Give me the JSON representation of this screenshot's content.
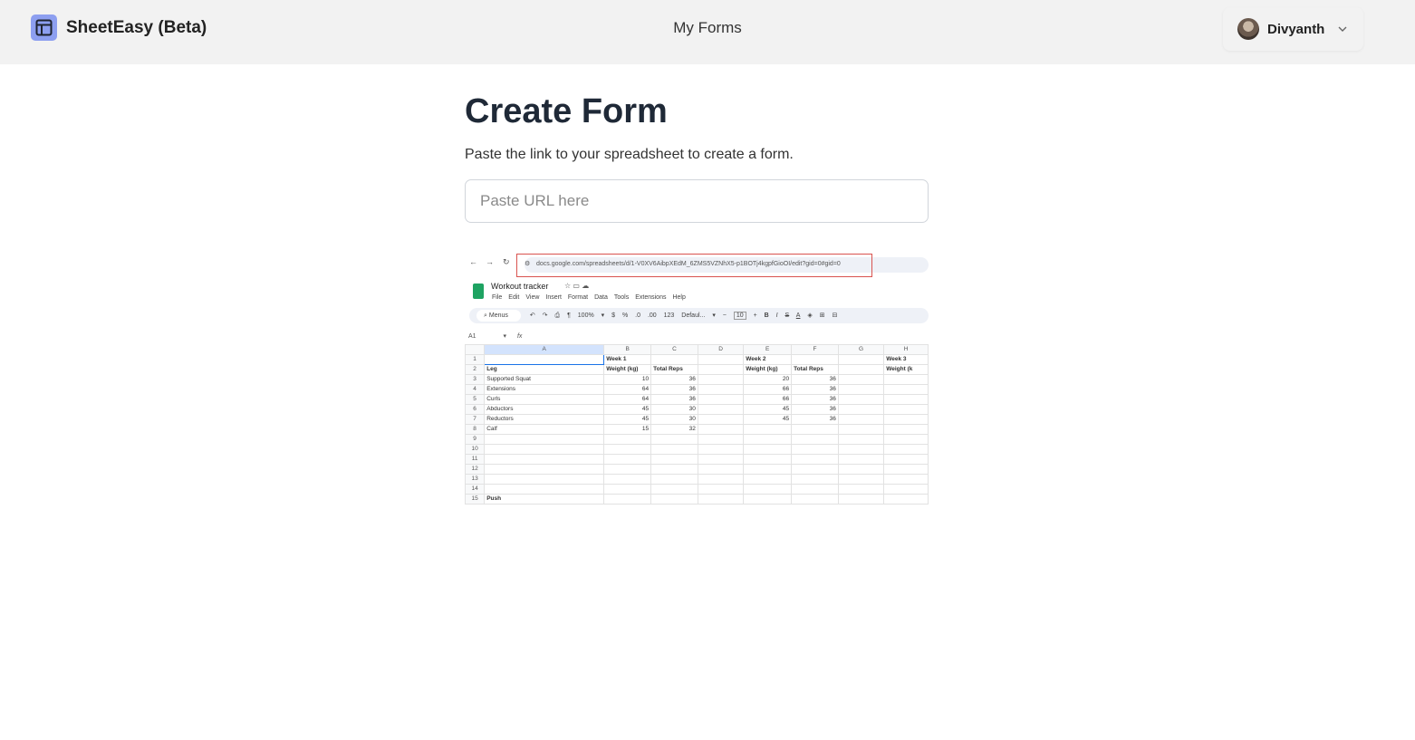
{
  "header": {
    "brand": "SheetEasy (Beta)",
    "nav_link": "My Forms",
    "user_name": "Divyanth"
  },
  "main": {
    "title": "Create Form",
    "subtitle": "Paste the link to your spreadsheet to create a form.",
    "url_placeholder": "Paste URL here"
  },
  "screenshot": {
    "url": "docs.google.com/spreadsheets/d/1-V0XV6AibpXEdM_6ZMS5VZNhX5-p1BOTj4kgpfGioOI/edit?gid=0#gid=0",
    "doc_title": "Workout tracker",
    "menus": [
      "File",
      "Edit",
      "View",
      "Insert",
      "Format",
      "Data",
      "Tools",
      "Extensions",
      "Help"
    ],
    "toolbar": {
      "search": "Menus",
      "zoom": "100%",
      "font": "Defaul...",
      "font_size": "10",
      "currency": "$",
      "percent": "%",
      "dec_minus": ".0",
      "dec_plus": ".00",
      "number_fmt": "123"
    },
    "cell_ref": "A1",
    "fx": "fx",
    "columns": [
      "A",
      "B",
      "C",
      "D",
      "E",
      "F",
      "G",
      "H"
    ],
    "rows": [
      {
        "n": "1",
        "cells": [
          "",
          "Week 1",
          "",
          "",
          "Week 2",
          "",
          "",
          "Week 3"
        ]
      },
      {
        "n": "2",
        "cells": [
          "Leg",
          "Weight (kg)",
          "Total Reps",
          "",
          "Weight (kg)",
          "Total Reps",
          "",
          "Weight (k"
        ]
      },
      {
        "n": "3",
        "cells": [
          "Supported Squat",
          "10",
          "36",
          "",
          "20",
          "36",
          "",
          ""
        ]
      },
      {
        "n": "4",
        "cells": [
          "Extensions",
          "64",
          "36",
          "",
          "66",
          "36",
          "",
          ""
        ]
      },
      {
        "n": "5",
        "cells": [
          "Curls",
          "64",
          "36",
          "",
          "66",
          "36",
          "",
          ""
        ]
      },
      {
        "n": "6",
        "cells": [
          "Abductors",
          "45",
          "30",
          "",
          "45",
          "36",
          "",
          ""
        ]
      },
      {
        "n": "7",
        "cells": [
          "Reductors",
          "45",
          "30",
          "",
          "45",
          "36",
          "",
          ""
        ]
      },
      {
        "n": "8",
        "cells": [
          "Calf",
          "15",
          "32",
          "",
          "",
          "",
          "",
          ""
        ]
      },
      {
        "n": "9",
        "cells": [
          "",
          "",
          "",
          "",
          "",
          "",
          "",
          ""
        ]
      },
      {
        "n": "10",
        "cells": [
          "",
          "",
          "",
          "",
          "",
          "",
          "",
          ""
        ]
      },
      {
        "n": "11",
        "cells": [
          "",
          "",
          "",
          "",
          "",
          "",
          "",
          ""
        ]
      },
      {
        "n": "12",
        "cells": [
          "",
          "",
          "",
          "",
          "",
          "",
          "",
          ""
        ]
      },
      {
        "n": "13",
        "cells": [
          "",
          "",
          "",
          "",
          "",
          "",
          "",
          ""
        ]
      },
      {
        "n": "14",
        "cells": [
          "",
          "",
          "",
          "",
          "",
          "",
          "",
          ""
        ]
      },
      {
        "n": "15",
        "cells": [
          "Push",
          "",
          "",
          "",
          "",
          "",
          "",
          ""
        ]
      }
    ]
  }
}
